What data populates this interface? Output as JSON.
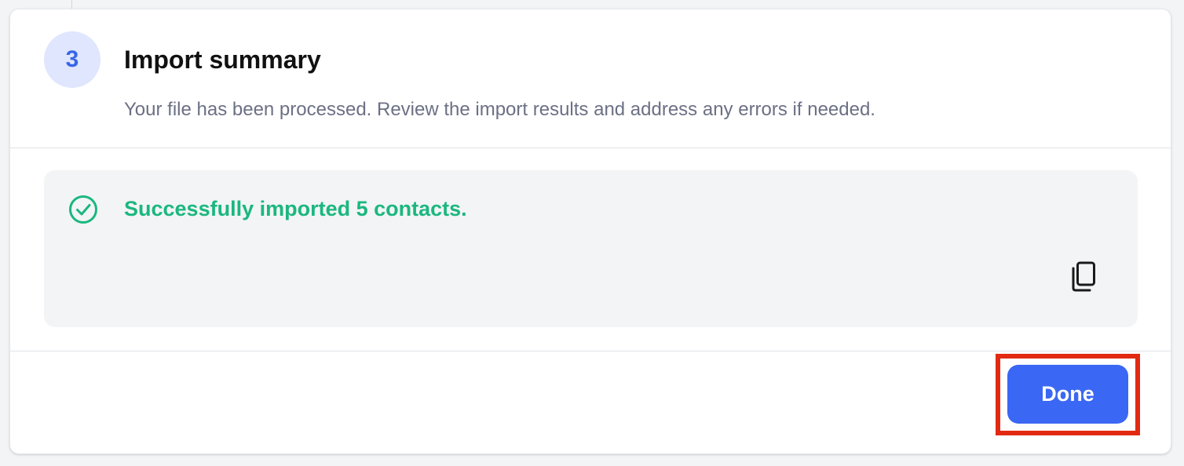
{
  "step": {
    "number": "3",
    "title": "Import summary",
    "description": "Your file has been processed. Review the import results and address any errors if needed."
  },
  "result": {
    "status": "success",
    "icon": "check-circle-icon",
    "message": "Successfully imported 5 contacts.",
    "copy_icon": "copy-icon"
  },
  "footer": {
    "done_label": "Done"
  },
  "colors": {
    "accent": "#3a67f4",
    "success": "#1bb77f",
    "badge_bg": "#dfe6fd",
    "highlight": "#e22a12"
  }
}
